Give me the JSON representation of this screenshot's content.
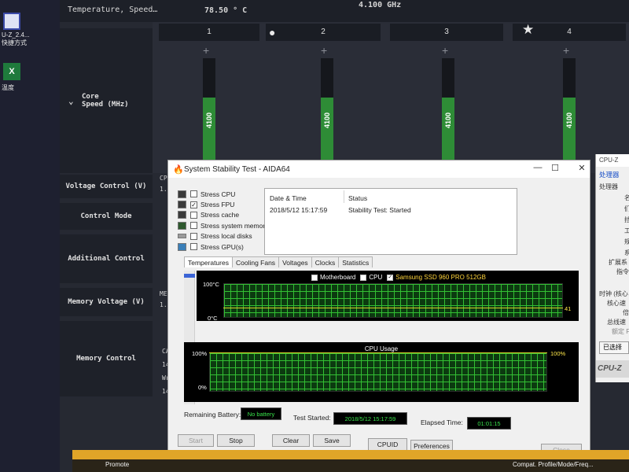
{
  "desktop": {
    "icons": [
      {
        "label": "U-Z_2.4...\n快捷方式",
        "icon": "cpuz-shortcut-icon"
      },
      {
        "label": "温度",
        "icon": "excel-file-icon"
      }
    ]
  },
  "bios": {
    "header": {
      "label": "Temperature, Speed…",
      "temperature": "78.50 ° C",
      "frequency": "4.100 GHz"
    },
    "rows": {
      "core_speed": "Core\nSpeed (MHz)",
      "voltage_control": "Voltage Control (V)",
      "control_mode": "Control Mode",
      "additional_control": "Additional Control",
      "memory_voltage": "Memory Voltage (V)",
      "memory_control": "Memory Control"
    },
    "cores": [
      {
        "index": "1",
        "speed": "4100",
        "level": 0.66
      },
      {
        "index": "2",
        "speed": "4100",
        "level": 0.66
      },
      {
        "index": "3",
        "speed": "4100",
        "level": 0.66
      },
      {
        "index": "4",
        "speed": "4100",
        "level": 0.66
      }
    ],
    "side_fragments": {
      "cp": "CP",
      "one": "1.",
      "me": "ME",
      "one_b": "1.",
      "ca": "CA",
      "n14a": "14",
      "wr": "Wr",
      "n14b": "14"
    }
  },
  "aida": {
    "title": "System Stability Test - AIDA64",
    "stress_items": [
      {
        "label": "Stress CPU",
        "checked": false
      },
      {
        "label": "Stress FPU",
        "checked": true
      },
      {
        "label": "Stress cache",
        "checked": false
      },
      {
        "label": "Stress system memory",
        "checked": false
      },
      {
        "label": "Stress local disks",
        "checked": false
      },
      {
        "label": "Stress GPU(s)",
        "checked": false
      }
    ],
    "status_table": {
      "col_datetime": "Date & Time",
      "col_status": "Status",
      "datetime": "2018/5/12 15:17:59",
      "status": "Stability Test: Started"
    },
    "tabs": [
      "Temperatures",
      "Cooling Fans",
      "Voltages",
      "Clocks",
      "Statistics"
    ],
    "temp_graph": {
      "legend": [
        {
          "label": "Motherboard",
          "checked": false
        },
        {
          "label": "CPU",
          "checked": false
        },
        {
          "label": "Samsung SSD 960 PRO 512GB",
          "checked": true
        }
      ],
      "y_max": "100°C",
      "y_min": "0°C",
      "current": "41"
    },
    "cpu_graph": {
      "title": "CPU Usage",
      "y_max": "100%",
      "y_min": "0%",
      "current": "100%"
    },
    "remaining_battery_label": "Remaining Battery:",
    "remaining_battery": "No battery",
    "test_started_label": "Test Started:",
    "test_started": "2018/5/12 15:17:59",
    "elapsed_label": "Elapsed Time:",
    "elapsed": "01:01:15",
    "buttons": {
      "start": "Start",
      "stop": "Stop",
      "clear": "Clear",
      "save": "Save",
      "cpuid": "CPUID",
      "preferences": "Preferences",
      "close": "Close"
    }
  },
  "cpuz": {
    "title": "CPU-Z",
    "tab": "处理器",
    "lines": [
      "处理器",
      "名",
      "们",
      "挡",
      "工",
      "规",
      "系",
      "扩展系",
      "指令",
      "时钟 (核心",
      "核心速",
      "倍",
      "总线速",
      "额定 F"
    ],
    "selection": "已选择",
    "brand": "CPU-Z"
  },
  "taskbar": {
    "left_text": "Promote",
    "right_text": "Compat. Profile/Mode/Freq..."
  }
}
